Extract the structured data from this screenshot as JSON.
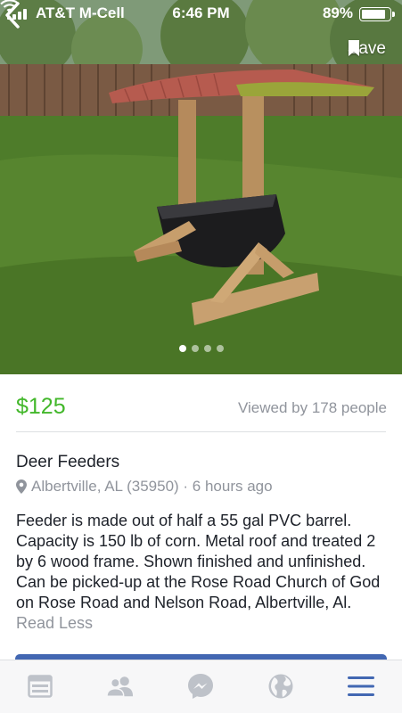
{
  "status_bar": {
    "carrier": "AT&T M-Cell",
    "time": "6:46 PM",
    "battery": "89%",
    "battery_level": 0.89
  },
  "header": {
    "back_icon": "chevron-left-icon",
    "save_label": "Save",
    "save_icon": "bookmark-icon"
  },
  "photo": {
    "page_count": 4,
    "active_page": 1
  },
  "listing": {
    "price": "$125",
    "viewed": "Viewed by 178 people",
    "title": "Deer Feeders",
    "location": "Albertville, AL (35950) · 6 hours ago",
    "location_icon": "map-pin-icon",
    "description": "Feeder is made out of half a 55 gal PVC barrel.  Capacity is 150 lb of corn.  Metal roof and treated 2 by 6 wood frame.  Shown finished and unfinished.  Can be picked-up at the Rose Road Church of God on Rose Road and Nelson Road, Albertville, Al.",
    "read_less": "Read Less"
  },
  "colors": {
    "price": "#42b72a",
    "muted": "#90949c",
    "accent": "#4267b2",
    "tab_icon": "#bec2c9"
  },
  "tab_bar": {
    "items": [
      {
        "icon": "news-feed-icon",
        "active": false
      },
      {
        "icon": "friends-icon",
        "active": false
      },
      {
        "icon": "messenger-icon",
        "active": false
      },
      {
        "icon": "globe-icon",
        "active": false
      },
      {
        "icon": "menu-icon",
        "active": true
      }
    ]
  }
}
